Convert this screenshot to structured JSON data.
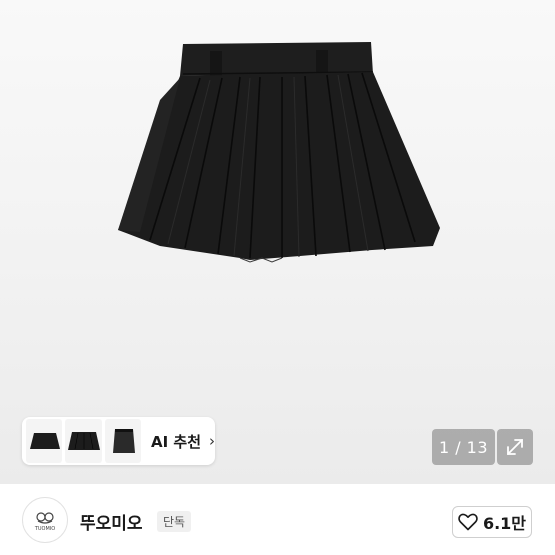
{
  "product_image": {
    "subject": "black pleated mini skirt",
    "counter": "1 / 13"
  },
  "thumbnails": [
    {
      "name": "thumb-1"
    },
    {
      "name": "thumb-2"
    },
    {
      "name": "thumb-3"
    }
  ],
  "ai_recommend": {
    "label": "AI 추천",
    "chevron": "›"
  },
  "icons": {
    "expand": "expand-icon",
    "heart": "heart-icon",
    "chevron": "chevron-right-icon"
  },
  "shop": {
    "name": "뚜오미오",
    "badge": "단독",
    "logo_text": "TUOMIO"
  },
  "like": {
    "count": "6.1만"
  },
  "colors": {
    "skirt": "#1c1c1c",
    "overlay": "#7a7a7a",
    "text": "#1a1a1a"
  }
}
